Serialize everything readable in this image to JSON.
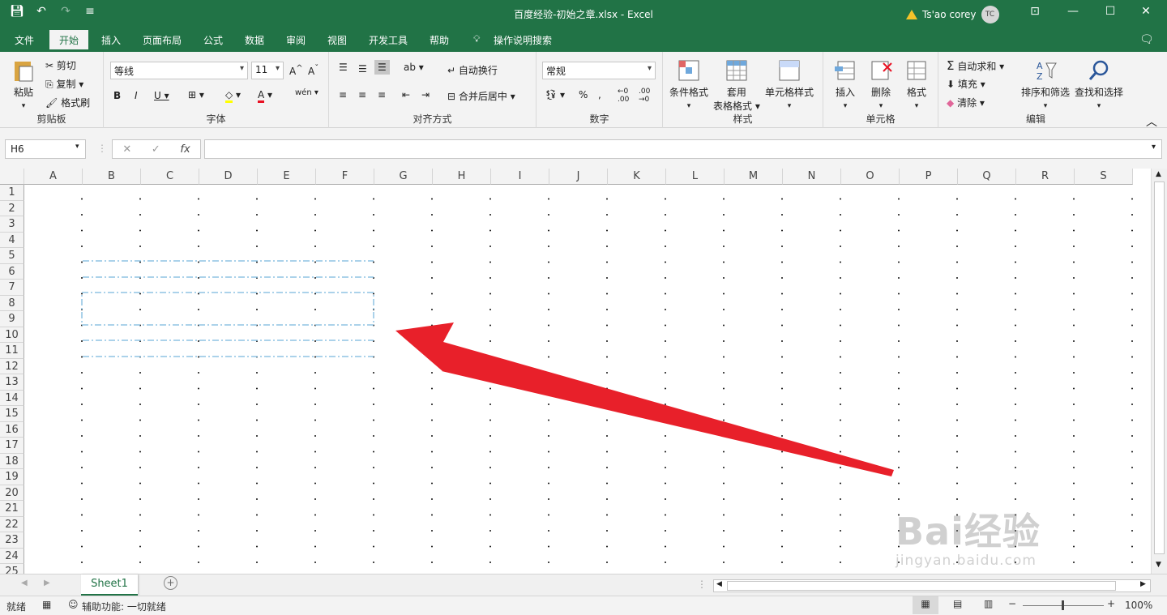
{
  "titlebar": {
    "title": "百度经验-初始之章.xlsx  -  Excel",
    "user_name": "Ts'ao corey",
    "avatar_initials": "TC",
    "qat_icons": [
      "save-icon",
      "undo-icon",
      "redo-icon",
      "customize-icon"
    ]
  },
  "menu": {
    "tabs": [
      "文件",
      "开始",
      "插入",
      "页面布局",
      "公式",
      "数据",
      "审阅",
      "视图",
      "开发工具",
      "帮助",
      "操作说明搜索"
    ],
    "active": "开始"
  },
  "ribbon": {
    "clipboard": {
      "paste": "粘贴",
      "cut": "剪切",
      "copy": "复制",
      "format_painter": "格式刷",
      "label": "剪贴板"
    },
    "font": {
      "name": "等线",
      "size": "11",
      "label": "字体"
    },
    "alignment": {
      "wrap": "自动换行",
      "merge": "合并后居中",
      "label": "对齐方式"
    },
    "number": {
      "format": "常规",
      "label": "数字"
    },
    "styles": {
      "conditional": "条件格式",
      "table_format_1": "套用",
      "table_format_2": "表格格式",
      "cell_styles": "单元格样式",
      "label": "样式"
    },
    "cells": {
      "insert": "插入",
      "delete": "删除",
      "format": "格式",
      "label": "单元格"
    },
    "editing": {
      "autosum": "自动求和",
      "fill": "填充",
      "clear": "清除",
      "sort": "排序和筛选",
      "find": "查找和选择",
      "label": "编辑"
    }
  },
  "formula_bar": {
    "name_box": "H6",
    "fx": "fx",
    "value": ""
  },
  "grid": {
    "columns": [
      "A",
      "B",
      "C",
      "D",
      "E",
      "F",
      "G",
      "H",
      "I",
      "J",
      "K",
      "L",
      "M",
      "N",
      "O",
      "P",
      "Q",
      "R",
      "S"
    ],
    "rows": [
      "1",
      "2",
      "3",
      "4",
      "5",
      "6",
      "7",
      "8",
      "9",
      "10",
      "11",
      "12",
      "13",
      "14",
      "15",
      "16",
      "17",
      "18",
      "19",
      "20",
      "21",
      "22",
      "23",
      "24",
      "25"
    ]
  },
  "sheets": {
    "tabs": [
      "Sheet1"
    ]
  },
  "status": {
    "ready": "就绪",
    "accessibility": "辅助功能: 一切就绪",
    "zoom": "100%"
  },
  "watermark": {
    "line1": "Bai经验",
    "line2": "jingyan.baidu.com"
  },
  "colors": {
    "brand": "#217346",
    "arrow": "#e8202a",
    "border_dash": "#8fc3e3"
  }
}
